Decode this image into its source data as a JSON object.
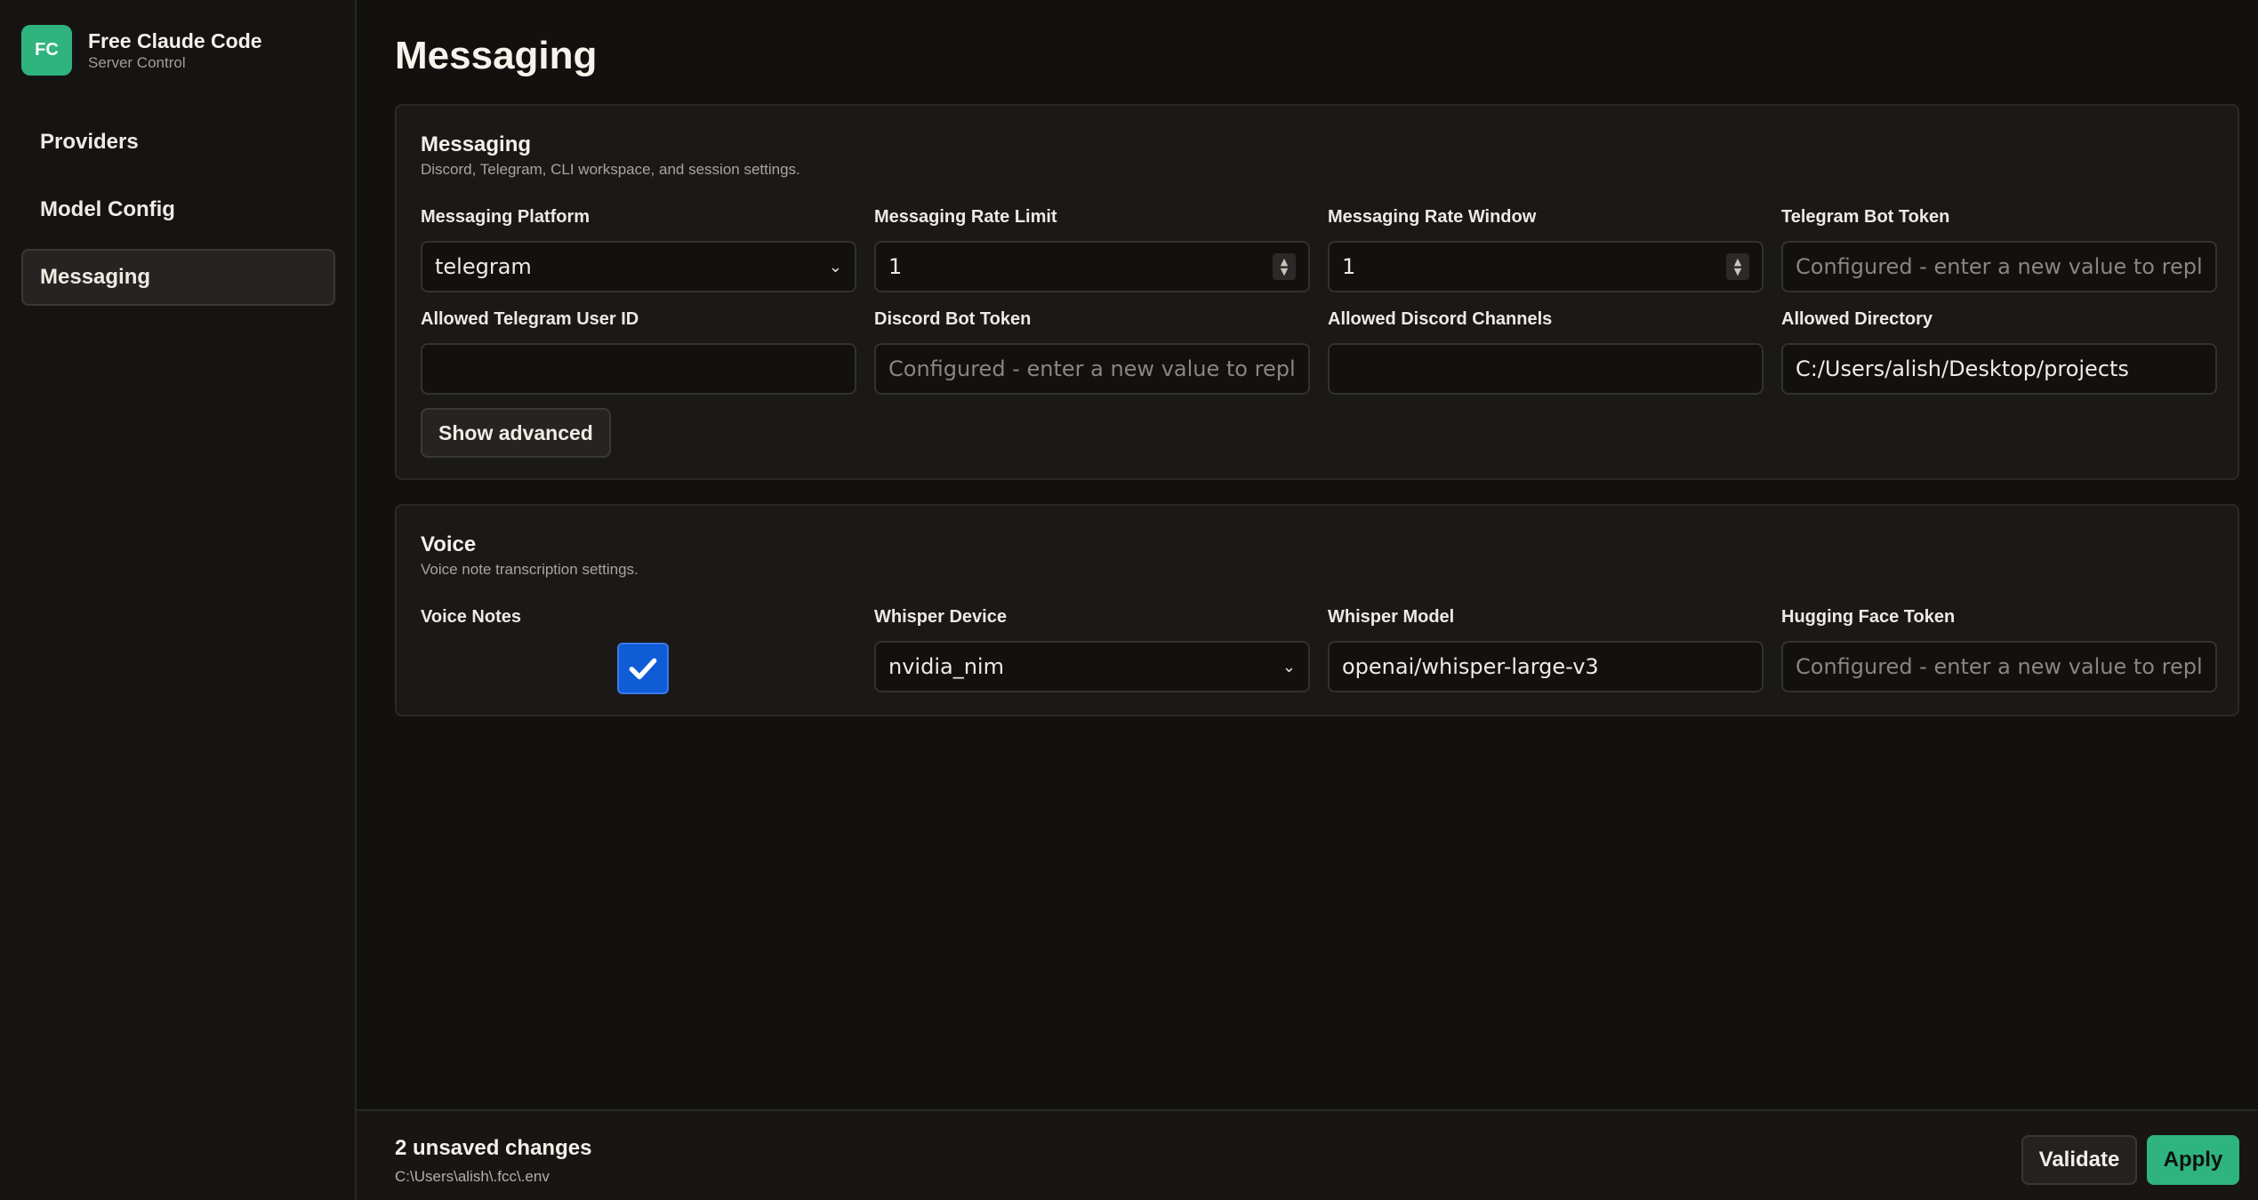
{
  "brand": {
    "logo": "FC",
    "title": "Free Claude Code",
    "subtitle": "Server Control"
  },
  "sidebar": {
    "items": [
      {
        "label": "Providers",
        "active": false
      },
      {
        "label": "Model Config",
        "active": false
      },
      {
        "label": "Messaging",
        "active": true
      }
    ]
  },
  "page": {
    "title": "Messaging"
  },
  "messaging": {
    "title": "Messaging",
    "description": "Discord, Telegram, CLI workspace, and session settings.",
    "fields": {
      "platform": {
        "label": "Messaging Platform",
        "value": "telegram"
      },
      "rate_limit": {
        "label": "Messaging Rate Limit",
        "value": "1"
      },
      "rate_window": {
        "label": "Messaging Rate Window",
        "value": "1"
      },
      "telegram_token": {
        "label": "Telegram Bot Token",
        "placeholder": "Configured - enter a new value to replace"
      },
      "telegram_user": {
        "label": "Allowed Telegram User ID",
        "value": ""
      },
      "discord_token": {
        "label": "Discord Bot Token",
        "placeholder": "Configured - enter a new value to replace"
      },
      "discord_channels": {
        "label": "Allowed Discord Channels",
        "value": ""
      },
      "directory": {
        "label": "Allowed Directory",
        "value": "C:/Users/alish/Desktop/projects"
      }
    },
    "show_advanced": "Show advanced"
  },
  "voice": {
    "title": "Voice",
    "description": "Voice note transcription settings.",
    "fields": {
      "voice_notes": {
        "label": "Voice Notes",
        "checked": true
      },
      "whisper_device": {
        "label": "Whisper Device",
        "value": "nvidia_nim"
      },
      "whisper_model": {
        "label": "Whisper Model",
        "value": "openai/whisper-large-v3"
      },
      "hf_token": {
        "label": "Hugging Face Token",
        "placeholder": "Configured - enter a new value to replace"
      }
    }
  },
  "footer": {
    "unsaved": "2 unsaved changes",
    "env_path": "C:\\Users\\alish\\.fcc\\.env",
    "validate_label": "Validate",
    "apply_label": "Apply"
  },
  "colors": {
    "accent": "#2fb37f",
    "checkbox": "#0f5cd6",
    "background": "#121110"
  },
  "icons": {
    "select": "chevron-down-icon",
    "number": "spinner-icon",
    "checkbox": "checkmark-icon"
  }
}
